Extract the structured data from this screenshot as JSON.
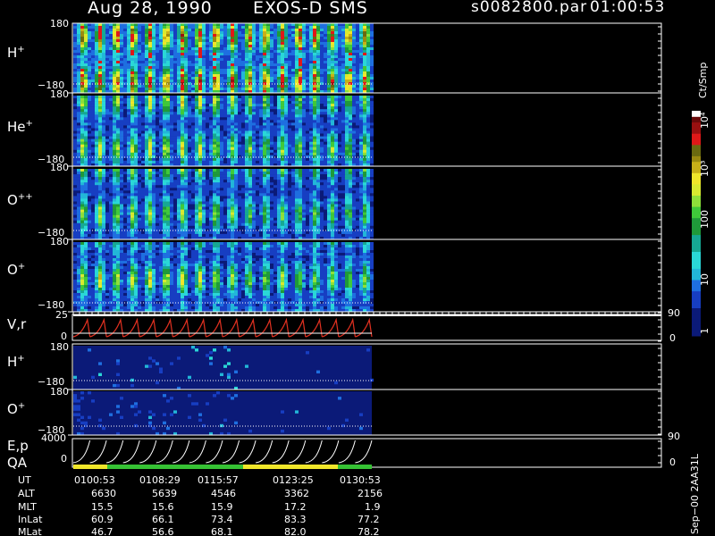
{
  "header": {
    "date": "Aug 28, 1990",
    "instrument": "EXOS-D SMS",
    "file": "s0082800.par",
    "time": "01:00:53"
  },
  "colors": {
    "background": "#000000",
    "panel_fill": "#0b1a78",
    "qa_bar": [
      "#f0e62a",
      "#36c234"
    ],
    "velocity_trace": "#e03020",
    "energy_trace": "#ffffff"
  },
  "panels": [
    {
      "species": "H",
      "charge": "+",
      "y_top": "180",
      "y_bottom": "−180"
    },
    {
      "species": "He",
      "charge": "+",
      "y_top": "180",
      "y_bottom": "−180"
    },
    {
      "species": "O",
      "charge": "++",
      "y_top": "180",
      "y_bottom": "−180"
    },
    {
      "species": "O",
      "charge": "+",
      "y_top": "180",
      "y_bottom": "−180"
    },
    {
      "species": "V,r",
      "charge": "",
      "y_top": "25",
      "y_bottom": "0",
      "r_top": "90",
      "r_bottom": "0"
    },
    {
      "species": "H",
      "charge": "+",
      "y_top": "180",
      "y_bottom": "−180"
    },
    {
      "species": "O",
      "charge": "+",
      "y_top": "180",
      "y_bottom": "−180"
    },
    {
      "species": "E,p",
      "charge": "",
      "y_top": "4000",
      "y_bottom": "0",
      "r_top": "90",
      "r_bottom": "0"
    }
  ],
  "qa_label": "QA",
  "colorbar": {
    "title": "Ct/Smp",
    "tick_labels": [
      {
        "value": 1,
        "label": "1"
      },
      {
        "value": 10,
        "label": "10"
      },
      {
        "value": 100,
        "label": "100"
      },
      {
        "value": 1000,
        "label": "10³"
      },
      {
        "value": 10000,
        "label": "10⁴"
      }
    ]
  },
  "footer": {
    "row_labels": [
      "UT",
      "ALT",
      "MLT",
      "InLat",
      "MLat"
    ],
    "columns": [
      [
        "0100:53",
        "6630",
        "15.5",
        "60.9",
        "46.7"
      ],
      [
        "0108:29",
        "5639",
        "15.6",
        "66.1",
        "56.6"
      ],
      [
        "0115:57",
        "4546",
        "15.9",
        "73.4",
        "68.1"
      ],
      [
        "0123:25",
        "3362",
        "17.2",
        "83.3",
        "82.0"
      ],
      [
        "0130:53",
        "2156",
        "1.9",
        "77.2",
        "78.2"
      ]
    ]
  },
  "side_note": "Sep−00 2AA31L",
  "chart_data": {
    "type": "heatmap",
    "title": "Aug 28, 1990   EXOS-D SMS",
    "x": {
      "label": "UT",
      "range": [
        "0100:53",
        "0130:53"
      ],
      "ticks": [
        "0100:53",
        "0108:29",
        "0115:57",
        "0123:25",
        "0130:53"
      ]
    },
    "color_scale": {
      "type": "log",
      "range": [
        1,
        10000
      ],
      "label": "Ct/Smp"
    },
    "heatmap_panels": [
      {
        "name": "H+",
        "ylim": [
          -180,
          180
        ]
      },
      {
        "name": "He+",
        "ylim": [
          -180,
          180
        ]
      },
      {
        "name": "O++",
        "ylim": [
          -180,
          180
        ]
      },
      {
        "name": "O+",
        "ylim": [
          -180,
          180
        ]
      },
      {
        "name": "H+ (second)",
        "ylim": [
          -180,
          180
        ]
      },
      {
        "name": "O+ (second)",
        "ylim": [
          -180,
          180
        ]
      }
    ],
    "line_panels": [
      {
        "name": "V,r",
        "ylim": [
          0,
          25
        ],
        "right_ylim": [
          0,
          90
        ]
      },
      {
        "name": "E,p",
        "ylim": [
          0,
          4000
        ],
        "right_ylim": [
          0,
          90
        ]
      }
    ],
    "spin_sweeps": 18,
    "grid": false,
    "legend": "right"
  }
}
